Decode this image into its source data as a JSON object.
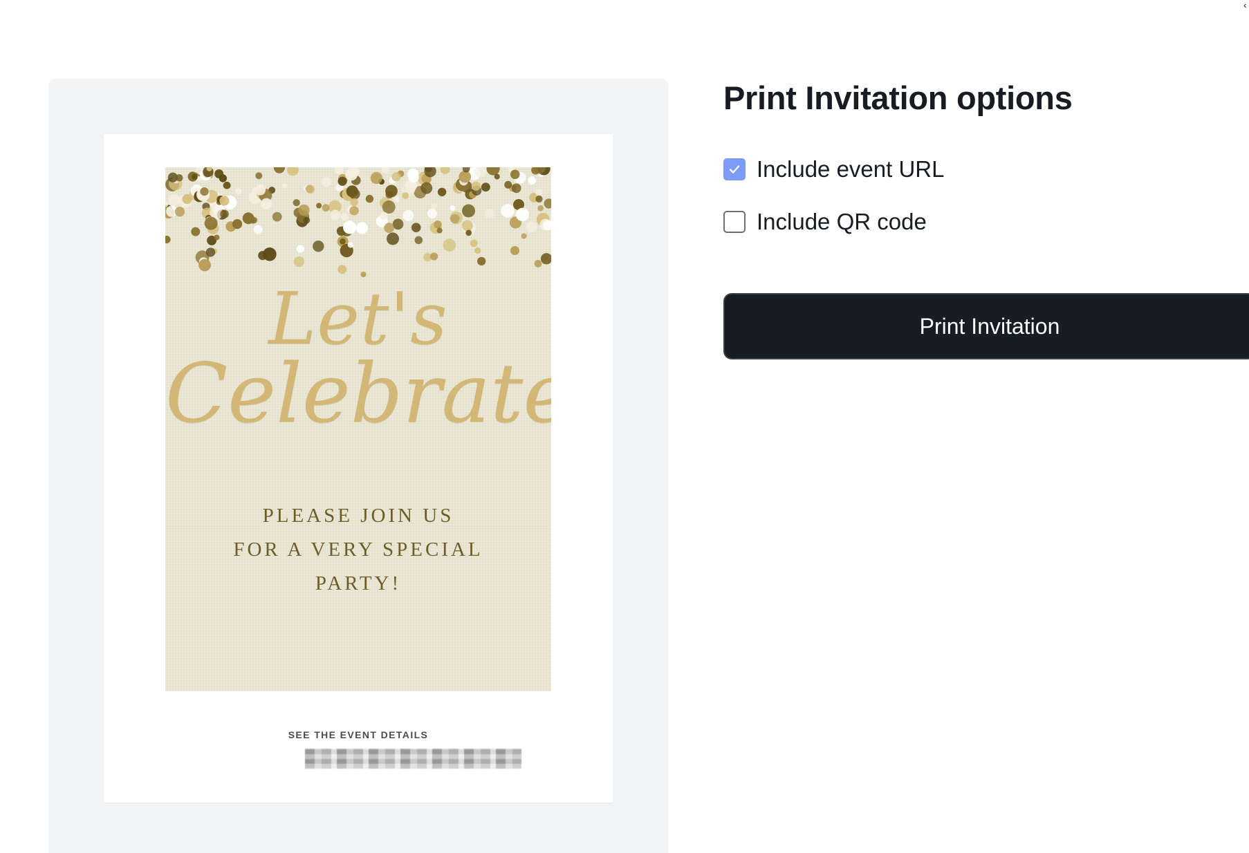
{
  "options": {
    "title": "Print Invitation options",
    "include_url": {
      "label": "Include event URL",
      "checked": true
    },
    "include_qr": {
      "label": "Include QR code",
      "checked": false
    },
    "print_button_label": "Print Invitation"
  },
  "preview": {
    "card_script_line1": "Let's",
    "card_script_line2": "Celebrate",
    "card_message_lines": [
      "PLEASE JOIN US",
      "FOR A VERY SPECIAL",
      "PARTY!"
    ],
    "event_details_label": "SEE THE EVENT DETAILS"
  },
  "colors": {
    "card_background": "#eae7d3",
    "gold_script": "#d3b777",
    "message_text": "#6e5d26",
    "checkbox_checked": "#7c9cf5",
    "button_background": "#161d24"
  }
}
